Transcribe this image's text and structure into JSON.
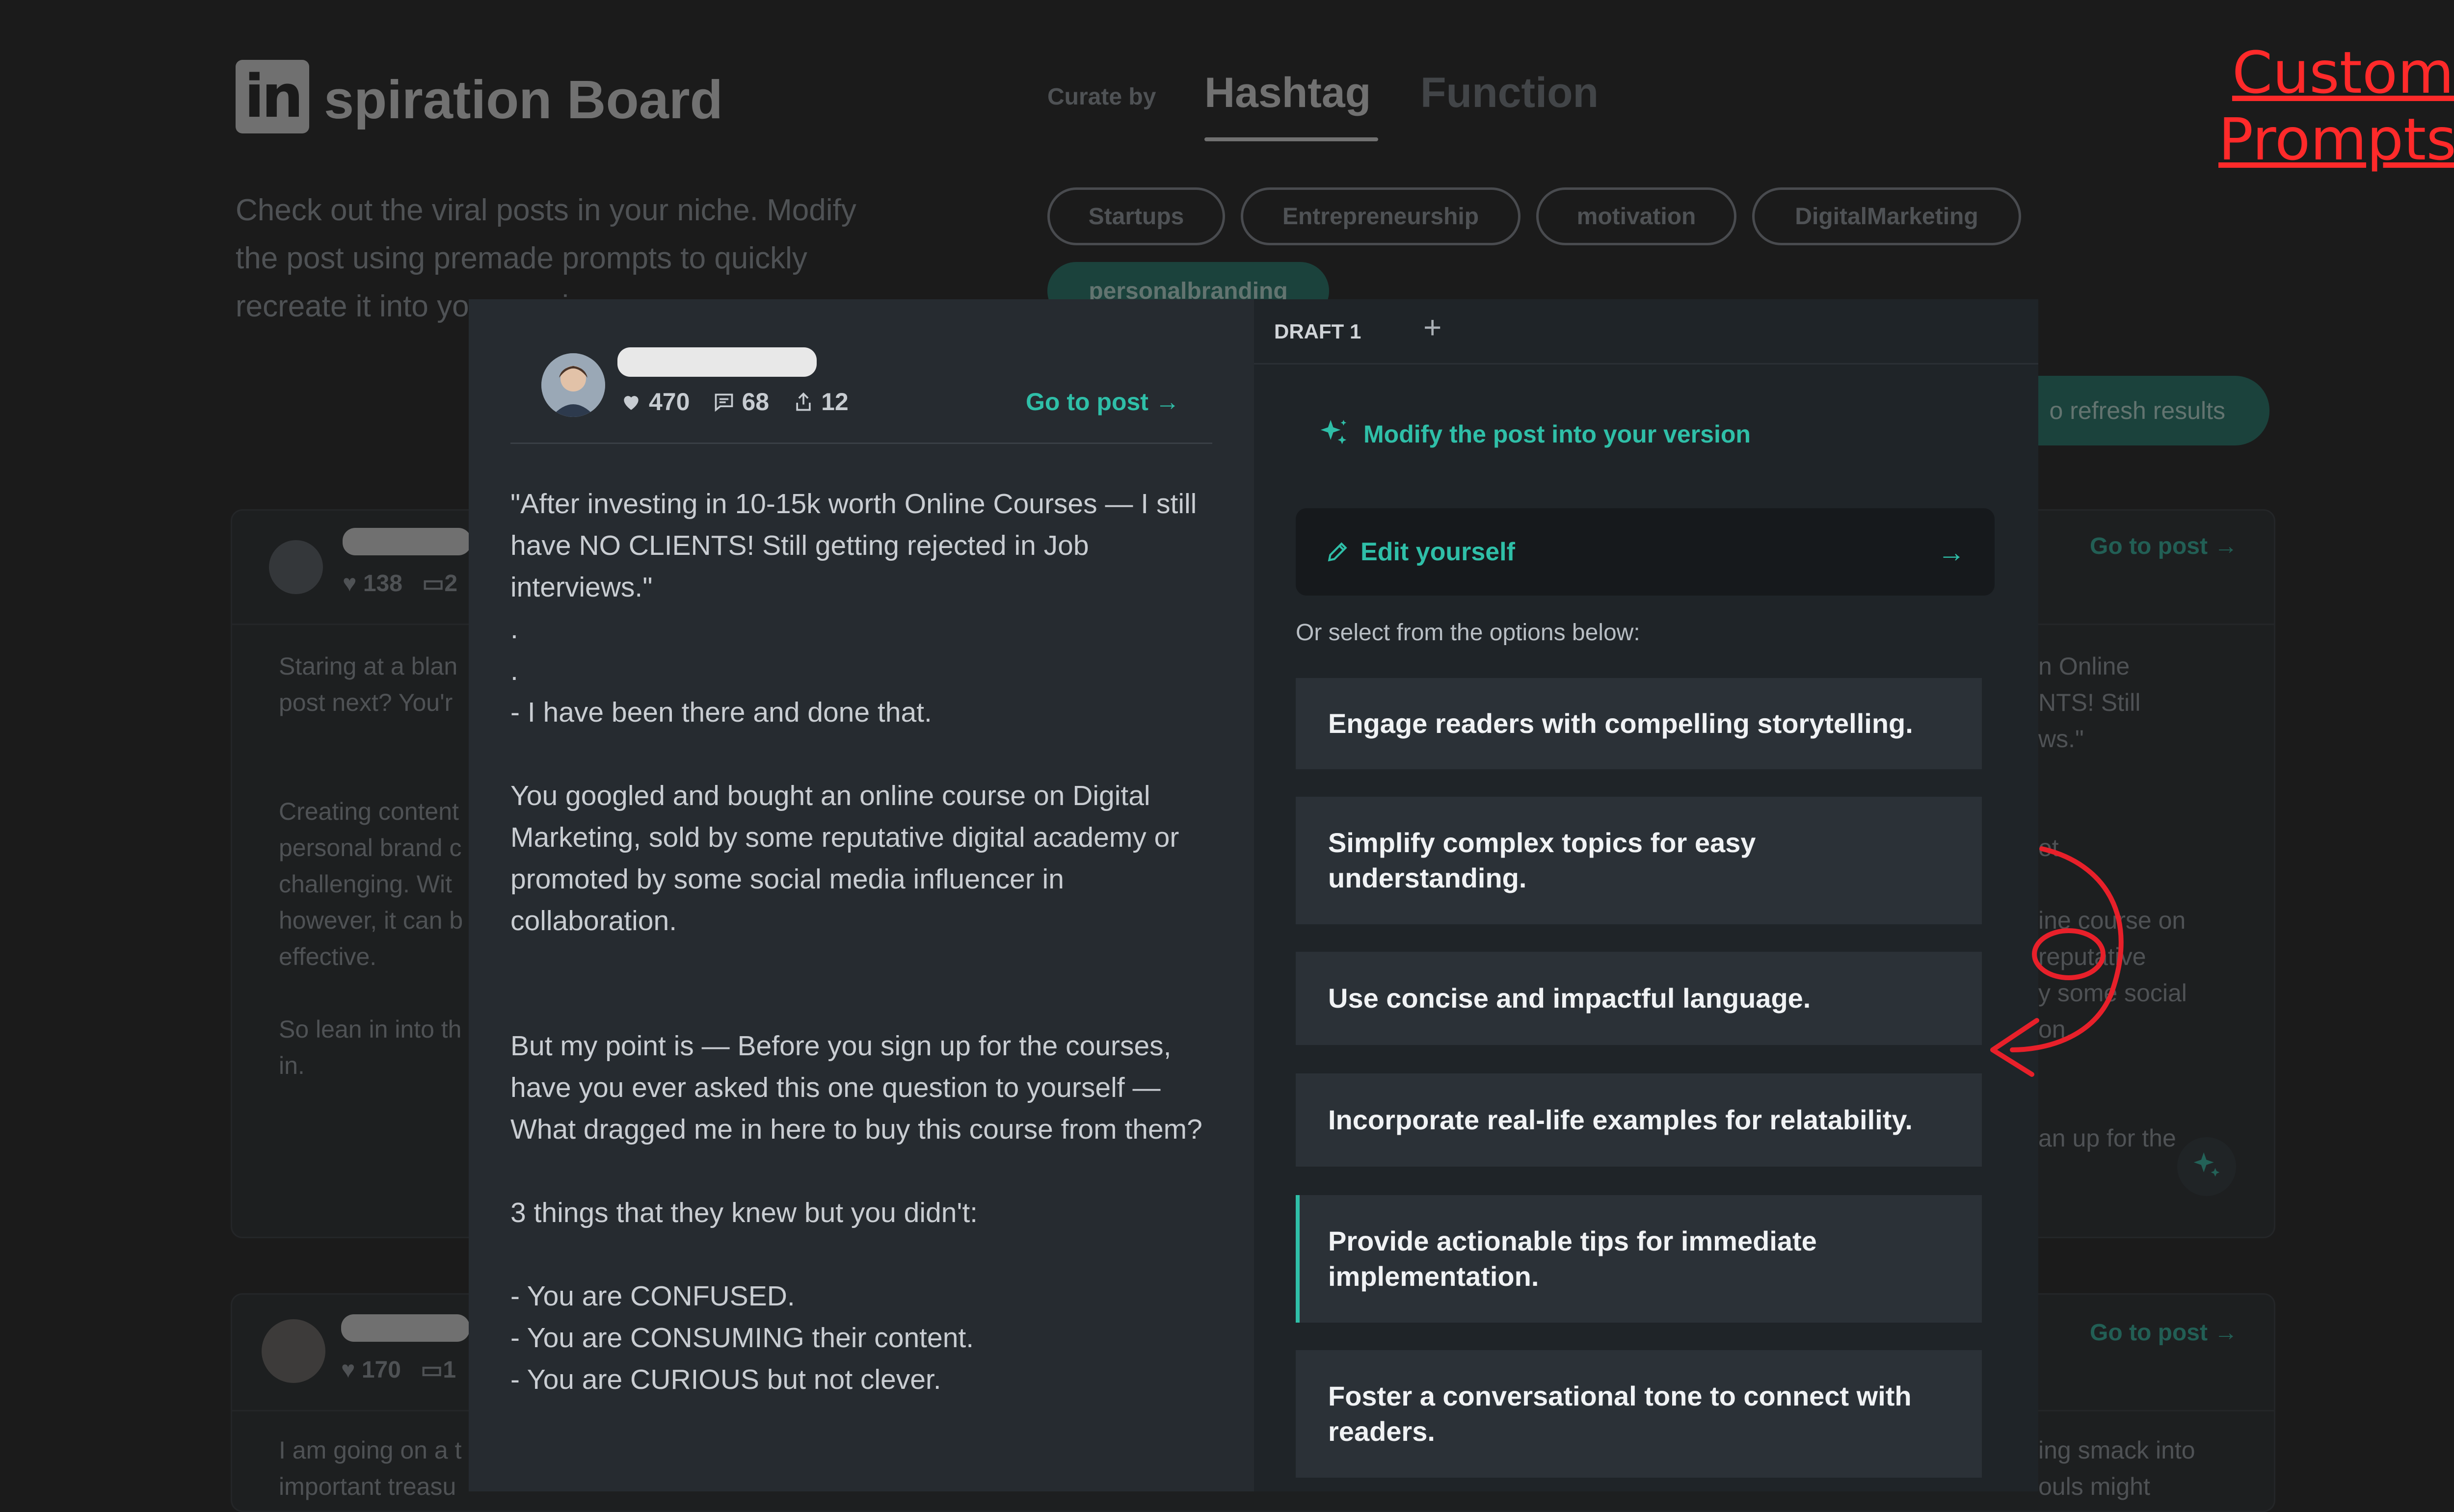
{
  "app": {
    "logo_glyph": "in",
    "logo_text": "spiration Board",
    "tagline": "Check out the viral posts in your niche. Modify the post using premade prompts to quickly recreate it into your version"
  },
  "curate": {
    "label": "Curate by",
    "tabs": [
      {
        "label": "Hashtag",
        "active": true
      },
      {
        "label": "Function",
        "active": false
      }
    ]
  },
  "chips": [
    "Startups",
    "Entrepreneurship",
    "motivation",
    "DigitalMarketing",
    "personalbranding"
  ],
  "refresh_label": "o refresh results",
  "annotation": {
    "custom_prompts": "Custom Prompts"
  },
  "bg_cards": [
    {
      "likes": "138",
      "comments": "2",
      "goto": "Go to post →",
      "left_text": [
        "Staring at a blan",
        "post next? You'r",
        "",
        "",
        "Creating content",
        "personal brand c",
        "challenging. Wit",
        "however, it can b",
        "effective.",
        "",
        "So lean in into th",
        "in."
      ],
      "right_text": [
        "n Online",
        "NTS! Still",
        "ws.\"",
        "",
        "",
        "et.",
        "",
        "ine course on",
        "reputative",
        "y some social",
        "on.",
        "",
        "",
        "an up for the"
      ]
    },
    {
      "likes": "170",
      "comments": "1",
      "goto": "Go to post →",
      "left_text": [
        "I am going on a t",
        "important treasu"
      ],
      "right_text": [
        "ing smack into",
        "ouls might"
      ]
    }
  ],
  "post": {
    "likes": "470",
    "comments": "68",
    "shares": "12",
    "goto": "Go to post →",
    "body": "\"After investing in 10-15k worth Online Courses — I still have NO CLIENTS! Still getting rejected in Job interviews.\"\n.\n.\n- I have been there and done that.\n\nYou googled and bought an online course on Digital Marketing, sold by some reputative digital academy or promoted by some social media influencer in collaboration.\n\n\nBut my point is — Before you sign up for the courses, have you ever asked this one question to yourself — What dragged me in here to buy this course from them?\n\n3 things that they knew but you didn't:\n\n- You are CONFUSED.\n- You are CONSUMING their content.\n- You are CURIOUS but not clever."
  },
  "drafts": {
    "tab_label": "DRAFT 1",
    "add_label": "+",
    "modify_heading": "Modify the post into your version",
    "edit_label": "Edit yourself",
    "or_select": "Or select from the options below:",
    "options": [
      "Engage readers with compelling storytelling.",
      "Simplify complex topics for easy understanding.",
      "Use concise and impactful language.",
      "Incorporate real-life examples for relatability.",
      "Provide actionable tips for immediate implementation.",
      "Foster a conversational tone to connect with readers."
    ],
    "active_option_index": 4
  },
  "colors": {
    "accent": "#2fbfa8",
    "annotation": "#ff2a2a",
    "background": "#1b1b1b"
  },
  "icons": [
    "sparkle-icon",
    "pencil-icon",
    "arrow-right-icon",
    "heart-icon",
    "comment-icon",
    "share-icon"
  ]
}
